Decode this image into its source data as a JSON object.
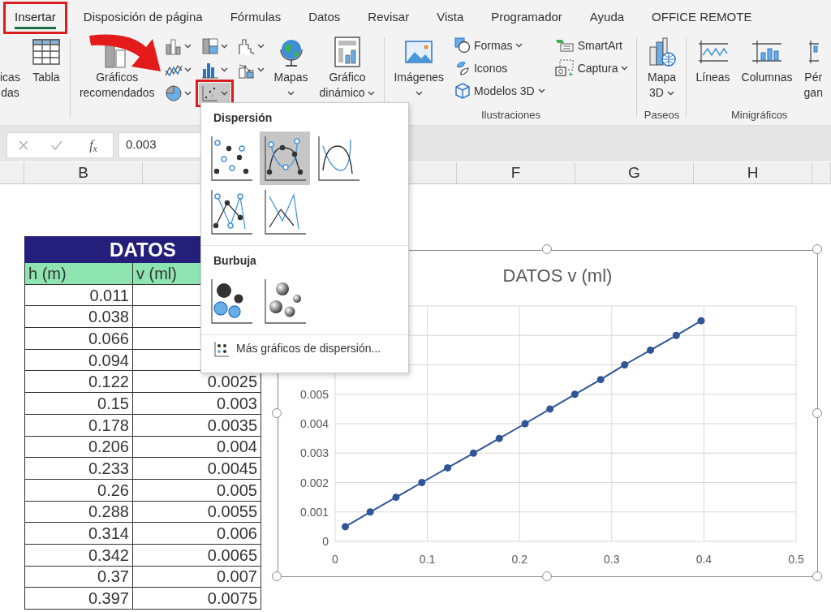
{
  "ribbon_tabs": [
    {
      "label": "Insertar",
      "selected": true,
      "annotated": true
    },
    {
      "label": "Disposición de página",
      "selected": false,
      "annotated": false
    },
    {
      "label": "Fórmulas",
      "selected": false,
      "annotated": false
    },
    {
      "label": "Datos",
      "selected": false,
      "annotated": false
    },
    {
      "label": "Revisar",
      "selected": false,
      "annotated": false
    },
    {
      "label": "Vista",
      "selected": false,
      "annotated": false
    },
    {
      "label": "Programador",
      "selected": false,
      "annotated": false
    },
    {
      "label": "Ayuda",
      "selected": false,
      "annotated": false
    },
    {
      "label": "OFFICE REMOTE",
      "selected": false,
      "annotated": false
    }
  ],
  "ribbon": {
    "groups": [
      {
        "buttons": [
          {
            "kind": "large",
            "lines": [
              "icas",
              "das"
            ],
            "dropdown": false
          },
          {
            "kind": "large",
            "lines": [
              "Tabla"
            ],
            "dropdown": false
          }
        ]
      },
      {
        "buttons": [
          {
            "kind": "large",
            "lines": [
              "Gráficos",
              "recomendados"
            ],
            "dropdown": false
          },
          {
            "kind": "icon-grid",
            "items": [
              {
                "dropdown": true,
                "expanded": false,
                "annotated": false
              },
              {
                "dropdown": true,
                "expanded": false,
                "annotated": false
              },
              {
                "dropdown": true,
                "expanded": false,
                "annotated": false
              },
              {
                "dropdown": true,
                "expanded": false,
                "annotated": false
              },
              {
                "dropdown": true,
                "expanded": false,
                "annotated": false
              },
              {
                "dropdown": true,
                "expanded": false,
                "annotated": false
              },
              {
                "dropdown": true,
                "expanded": false,
                "annotated": false
              },
              {
                "dropdown": true,
                "expanded": true,
                "annotated": true
              }
            ]
          },
          {
            "kind": "large",
            "lines": [
              "Mapas"
            ],
            "dropdown": true
          },
          {
            "kind": "large",
            "lines": [
              "Gráfico",
              "dinámico"
            ],
            "dropdown": true
          }
        ]
      },
      {
        "label": "Ilustraciones",
        "buttons": [
          {
            "kind": "large",
            "lines": [
              "Imágenes"
            ],
            "dropdown": true
          },
          {
            "kind": "small-stack",
            "items": [
              {
                "label": "Formas",
                "dropdown": true
              },
              {
                "label": "Iconos",
                "dropdown": false
              },
              {
                "label": "Modelos 3D",
                "dropdown": true
              }
            ]
          },
          {
            "kind": "small-stack",
            "items": [
              {
                "label": "SmartArt",
                "dropdown": false
              },
              {
                "label": "Captura",
                "dropdown": true
              }
            ]
          }
        ]
      },
      {
        "label": "Paseos",
        "buttons": [
          {
            "kind": "large",
            "lines": [
              "Mapa",
              "3D"
            ],
            "dropdown": true
          }
        ]
      },
      {
        "label": "Minigráficos",
        "buttons": [
          {
            "kind": "large",
            "lines": [
              "Líneas"
            ],
            "dropdown": false
          },
          {
            "kind": "large",
            "lines": [
              "Columnas"
            ],
            "dropdown": false
          },
          {
            "kind": "large",
            "lines": [
              "Pér",
              "gan"
            ],
            "dropdown": false
          }
        ]
      }
    ]
  },
  "formula_bar": {
    "function_label": "f$_{x}$",
    "value": "0.003"
  },
  "column_headers": [
    "B",
    "F",
    "G",
    "H"
  ],
  "table": {
    "title": "DATOS",
    "columns": [
      "h (m)",
      "v (ml)"
    ],
    "rows": [
      {
        "h": "0.011"
      },
      {
        "h": "0.038"
      },
      {
        "h": "0.066"
      },
      {
        "h": "0.094"
      },
      {
        "h": "0.122",
        "v": "0.0025"
      },
      {
        "h": "0.15",
        "v": "0.003"
      },
      {
        "h": "0.178",
        "v": "0.0035"
      },
      {
        "h": "0.206",
        "v": "0.004"
      },
      {
        "h": "0.233",
        "v": "0.0045"
      },
      {
        "h": "0.26",
        "v": "0.005"
      },
      {
        "h": "0.288",
        "v": "0.0055"
      },
      {
        "h": "0.314",
        "v": "0.006"
      },
      {
        "h": "0.342",
        "v": "0.0065"
      },
      {
        "h": "0.37",
        "v": "0.007"
      },
      {
        "h": "0.397",
        "v": "0.0075"
      }
    ]
  },
  "chart": {
    "chart_data": {
      "type": "line",
      "title": "DATOS v (ml)",
      "grid": true,
      "x": [
        0.011,
        0.038,
        0.066,
        0.094,
        0.122,
        0.15,
        0.178,
        0.206,
        0.233,
        0.26,
        0.288,
        0.314,
        0.342,
        0.37,
        0.397
      ],
      "series": [
        {
          "color": "#2f5597",
          "marker": "circle",
          "values": [
            0.0005,
            0.001,
            0.0015,
            0.002,
            0.0025,
            0.003,
            0.0035,
            0.004,
            0.0045,
            0.005,
            0.0055,
            0.006,
            0.0065,
            0.007,
            0.0075
          ]
        }
      ],
      "xlim": [
        0,
        0.5
      ],
      "ylim": [
        0,
        0.008
      ],
      "xticks": [
        0,
        0.1,
        0.2,
        0.3,
        0.4,
        0.5
      ],
      "yticks": [
        0,
        0.001,
        0.002,
        0.003,
        0.004,
        0.005
      ]
    }
  },
  "dropdown_menu": {
    "sections": [
      {
        "title": "Dispersión",
        "items": [
          {
            "selected": false
          },
          {
            "selected": true
          },
          {
            "selected": false
          },
          {
            "selected": false
          },
          {
            "selected": false
          }
        ]
      },
      {
        "title": "Burbuja",
        "items": [
          {
            "selected": false
          },
          {
            "selected": false
          }
        ]
      }
    ],
    "footer_link": "Más gráficos de dispersión..."
  }
}
